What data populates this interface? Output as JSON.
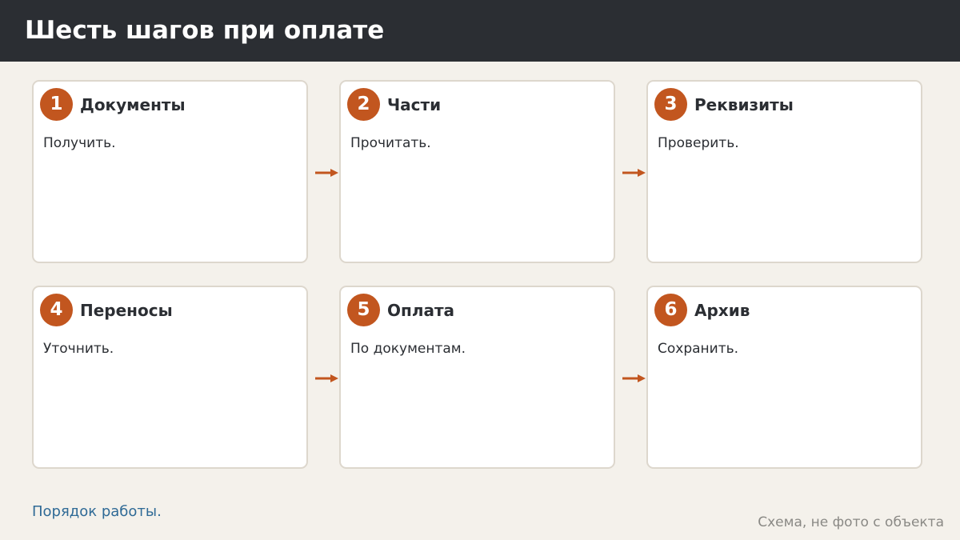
{
  "header": {
    "title": "Шесть шагов при оплате"
  },
  "steps": [
    {
      "number": "1",
      "title": "Документы",
      "desc": "Получить."
    },
    {
      "number": "2",
      "title": "Части",
      "desc": "Прочитать."
    },
    {
      "number": "3",
      "title": "Реквизиты",
      "desc": "Проверить."
    },
    {
      "number": "4",
      "title": "Переносы",
      "desc": "Уточнить."
    },
    {
      "number": "5",
      "title": "Оплата",
      "desc": "По документам."
    },
    {
      "number": "6",
      "title": "Архив",
      "desc": "Сохранить."
    }
  ],
  "footer": {
    "note": "Порядок работы.",
    "caption": "Схема, не фото с объекта"
  },
  "colors": {
    "header_bg": "#2b2e33",
    "page_bg": "#f4f1eb",
    "accent": "#c2561f",
    "card_border": "#ddd7cd",
    "link": "#2f6a96",
    "muted": "#8a8985"
  }
}
